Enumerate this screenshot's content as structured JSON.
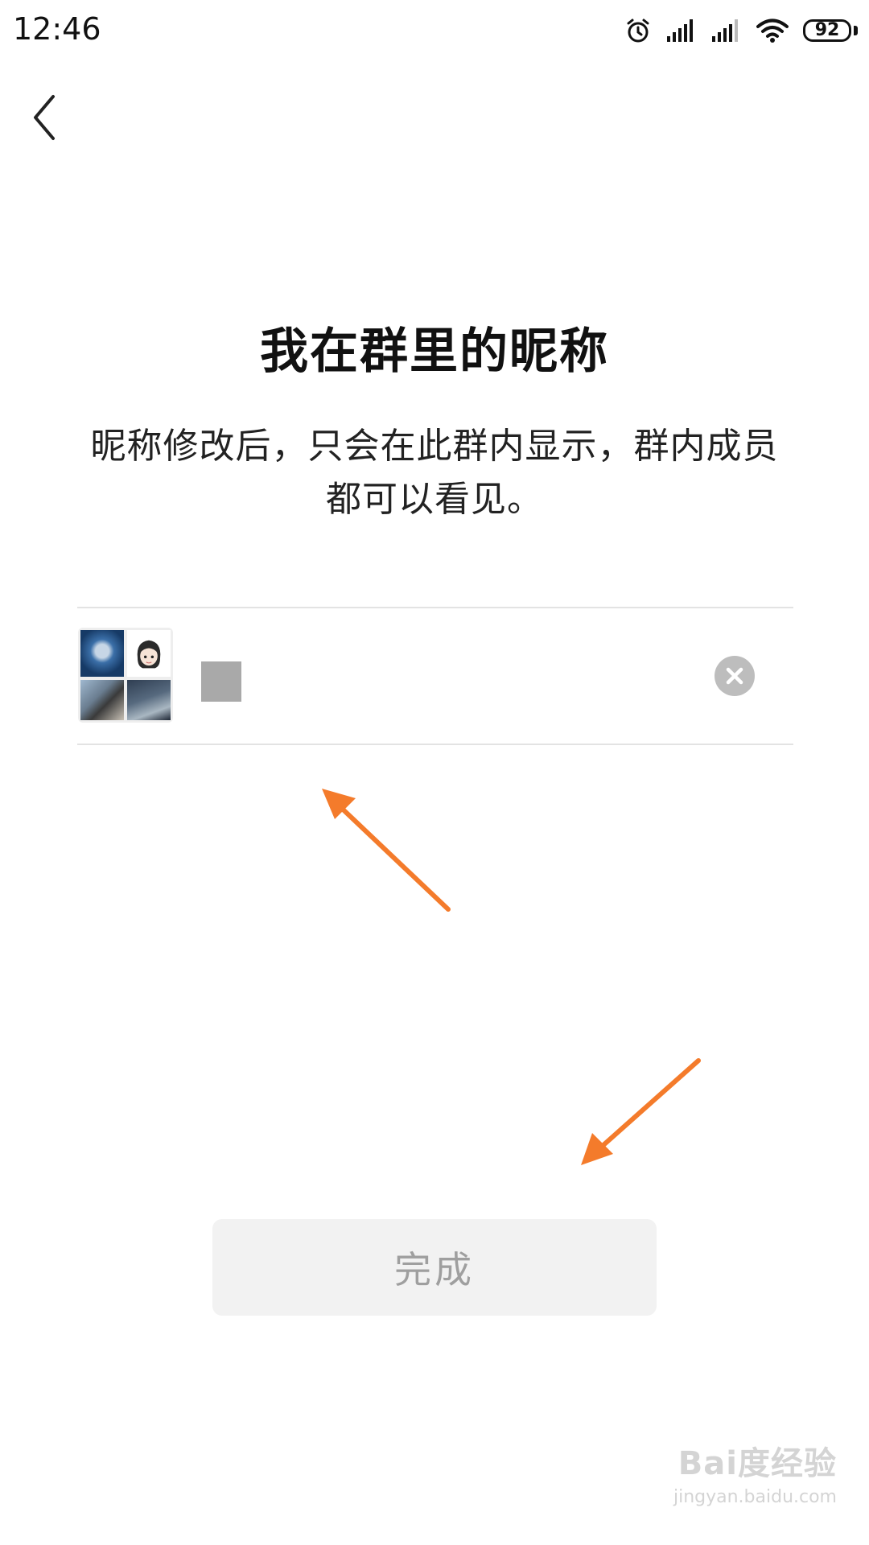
{
  "status_bar": {
    "time": "12:46",
    "battery": "92",
    "icons": [
      "alarm-icon",
      "signal-icon",
      "signal-icon",
      "wifi-icon",
      "battery-icon"
    ]
  },
  "nav": {
    "back_icon": "chevron-left-icon"
  },
  "main": {
    "title": "我在群里的昵称",
    "description": "昵称修改后，只会在此群内显示，群内成员都可以看见。"
  },
  "nickname_field": {
    "value": "",
    "avatar_icon": "group-avatar",
    "clear_icon": "clear-icon"
  },
  "done_button": {
    "label": "完成"
  },
  "watermark": {
    "logo": "Bai度经验",
    "url": "jingyan.baidu.com"
  },
  "colors": {
    "arrow": "#f47b2b",
    "button_bg": "#f2f2f2",
    "button_text": "#9f9f9f",
    "divider": "#e3e3e3"
  }
}
